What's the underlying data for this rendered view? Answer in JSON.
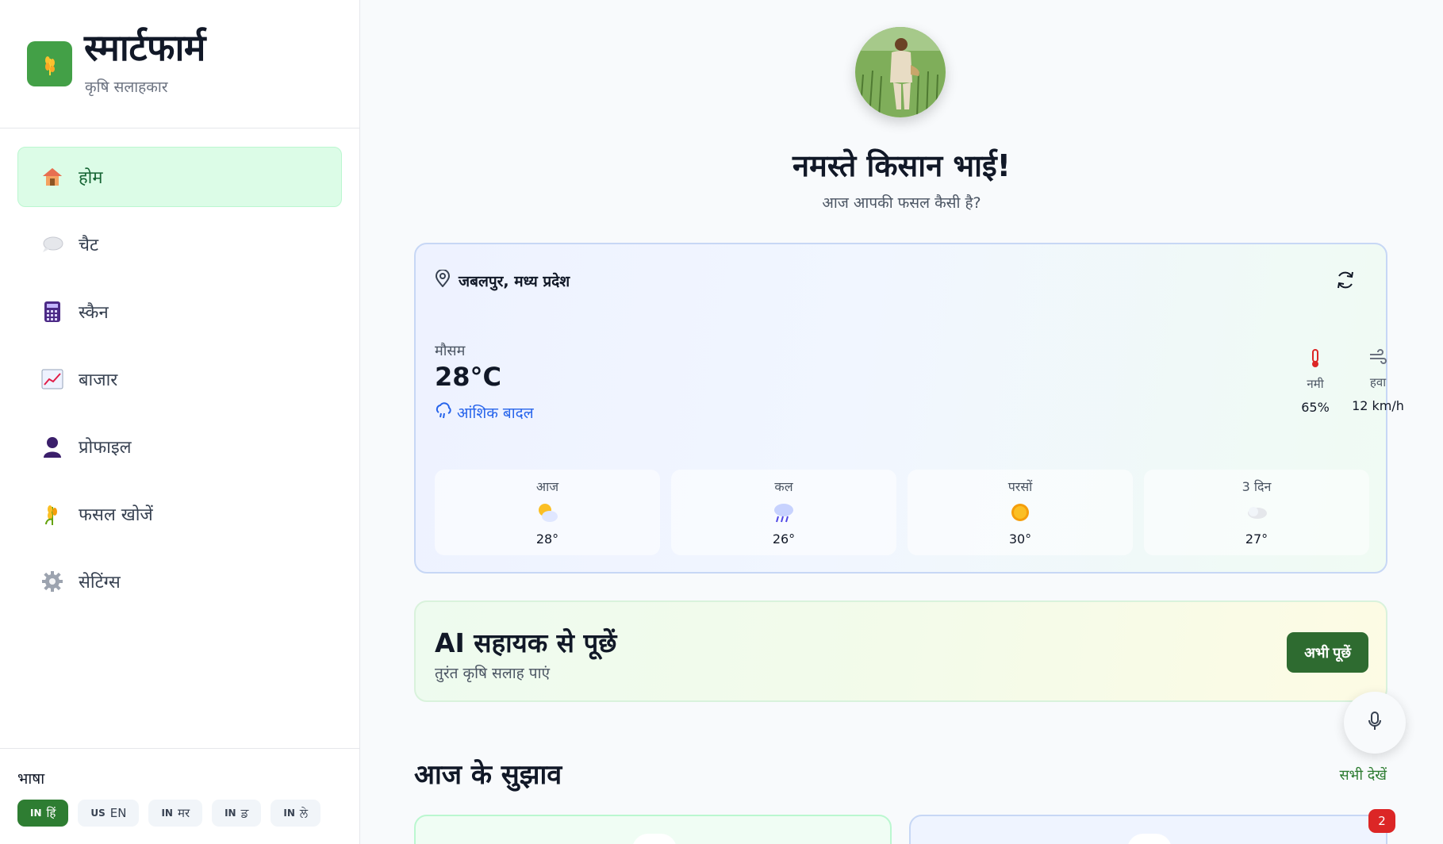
{
  "brand": {
    "title": "स्मार्टफार्म",
    "subtitle": "कृषि सलाहकार",
    "logo_icon": "wheat-icon",
    "accent": "#43a047"
  },
  "nav": [
    {
      "label": "होम",
      "icon": "house-icon",
      "active": true
    },
    {
      "label": "चैट",
      "icon": "speech-bubble-icon"
    },
    {
      "label": "स्कैन",
      "icon": "calculator-icon"
    },
    {
      "label": "बाजार",
      "icon": "chart-up-icon"
    },
    {
      "label": "प्रोफाइल",
      "icon": "person-icon"
    },
    {
      "label": "फसल खोजें",
      "icon": "crop-icon"
    },
    {
      "label": "सेटिंग्स",
      "icon": "gear-icon"
    }
  ],
  "language": {
    "title": "भाषा",
    "options": [
      {
        "code": "IN",
        "label": "हिं",
        "active": true
      },
      {
        "code": "US",
        "label": "EN"
      },
      {
        "code": "IN",
        "label": "मर"
      },
      {
        "code": "IN",
        "label": "ਡ"
      },
      {
        "code": "IN",
        "label": "ਲੇ"
      }
    ]
  },
  "greeting": {
    "title": "नमस्ते किसान भाई!",
    "subtitle": "आज आपकी फसल कैसी है?"
  },
  "weather": {
    "location": "जबलपुर, मध्य प्रदेश",
    "label": "मौसम",
    "temperature": "28°C",
    "condition": "आंशिक बादल",
    "humidity": {
      "label": "नमी",
      "value": "65%",
      "icon": "thermometer-icon"
    },
    "wind": {
      "label": "हवा",
      "value": "12 km/h",
      "icon": "wind-icon"
    },
    "forecast": [
      {
        "day": "आज",
        "temp": "28°",
        "icon": "sun-behind-cloud-icon"
      },
      {
        "day": "कल",
        "temp": "26°",
        "icon": "rain-cloud-icon"
      },
      {
        "day": "परसों",
        "temp": "30°",
        "icon": "sun-icon"
      },
      {
        "day": "3 दिन",
        "temp": "27°",
        "icon": "cloud-icon"
      }
    ]
  },
  "ai": {
    "title": "AI सहायक से पूछें",
    "subtitle": "तुरंत कृषि सलाह पाएं",
    "button": "अभी पूछें"
  },
  "tips": {
    "title": "आज के सुझाव",
    "see_all": "सभी देखें",
    "badge": "2"
  },
  "colors": {
    "primary": "#2e7d32",
    "active_nav_bg": "#dcfce7",
    "badge": "#dc2626",
    "link": "#2563eb"
  }
}
